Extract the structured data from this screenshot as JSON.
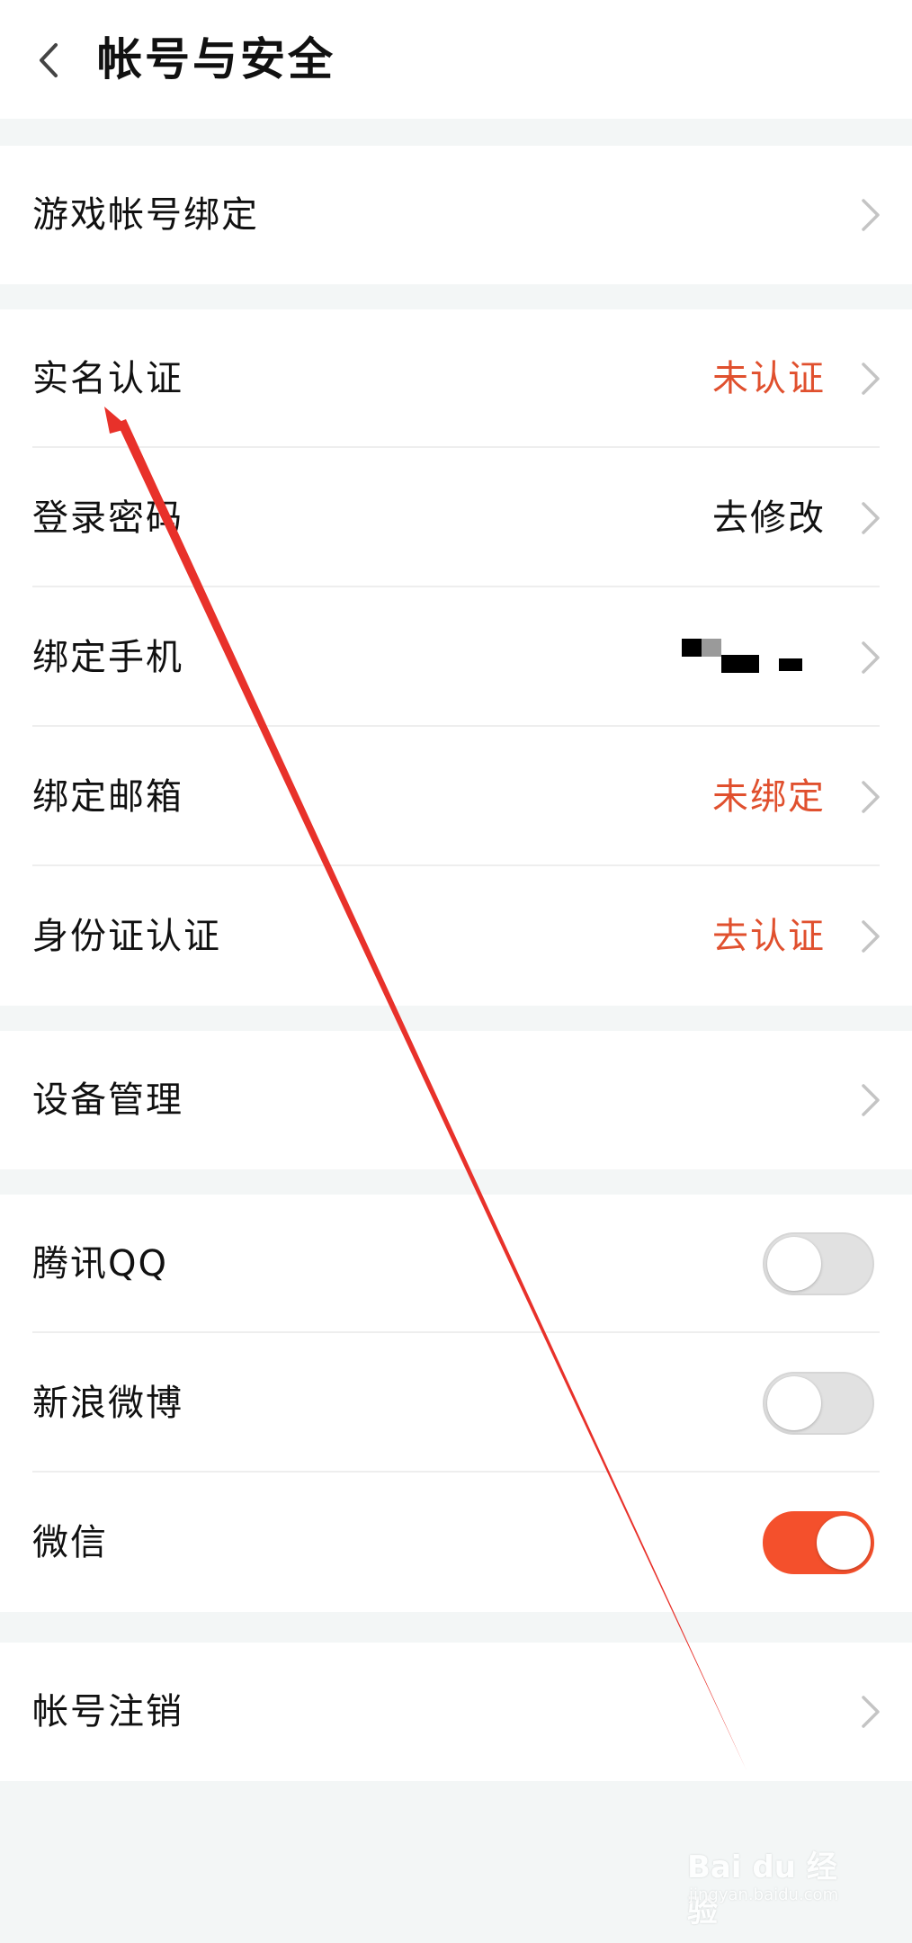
{
  "header": {
    "title": "帐号与安全"
  },
  "sections": {
    "game": {
      "items": [
        {
          "label": "游戏帐号绑定"
        }
      ]
    },
    "security": {
      "items": [
        {
          "label": "实名认证",
          "value": "未认证",
          "status": "alert"
        },
        {
          "label": "登录密码",
          "value": "去修改",
          "status": "normal"
        },
        {
          "label": "绑定手机",
          "value": "",
          "status": "masked"
        },
        {
          "label": "绑定邮箱",
          "value": "未绑定",
          "status": "alert"
        },
        {
          "label": "身份证认证",
          "value": "去认证",
          "status": "alert"
        }
      ]
    },
    "device": {
      "items": [
        {
          "label": "设备管理"
        }
      ]
    },
    "social": {
      "items": [
        {
          "label": "腾讯QQ",
          "enabled": false
        },
        {
          "label": "新浪微博",
          "enabled": false
        },
        {
          "label": "微信",
          "enabled": true
        }
      ]
    },
    "account": {
      "items": [
        {
          "label": "帐号注销"
        }
      ]
    }
  },
  "watermark": {
    "brand": "Bai du 经验",
    "site": "jingyan.baidu.com"
  },
  "colors": {
    "alert": "#e0502e",
    "toggle_on": "#f4502c",
    "toggle_off": "#e1e1e1",
    "background": "#f3f6f6",
    "arrow": "#e8312a"
  },
  "icons": {
    "back": "chevron-left-icon",
    "row_arrow": "chevron-right-icon"
  }
}
